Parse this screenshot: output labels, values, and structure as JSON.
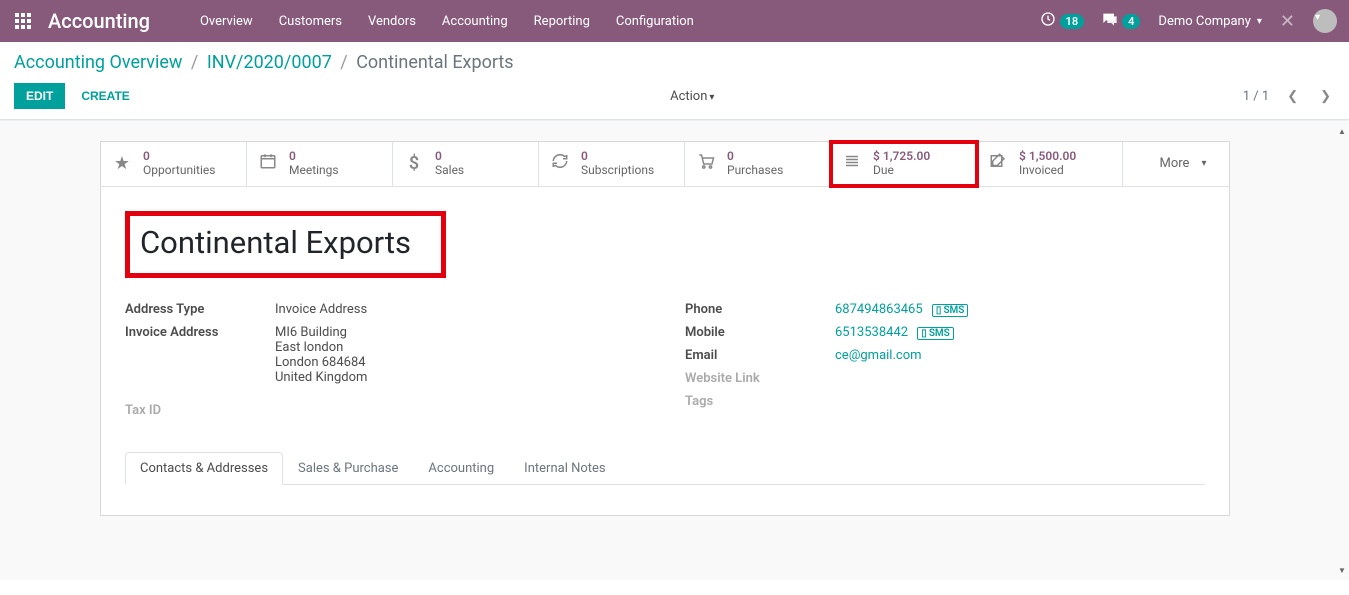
{
  "topnav": {
    "brand": "Accounting",
    "items": [
      "Overview",
      "Customers",
      "Vendors",
      "Accounting",
      "Reporting",
      "Configuration"
    ],
    "clock_badge": "18",
    "chat_badge": "4",
    "company": "Demo Company"
  },
  "breadcrumb": {
    "a": "Accounting Overview",
    "b": "INV/2020/0007",
    "current": "Continental Exports"
  },
  "buttons": {
    "edit": "EDIT",
    "create": "CREATE",
    "action": "Action"
  },
  "pager": {
    "text": "1 / 1"
  },
  "stats": {
    "opportunities": {
      "value": "0",
      "label": "Opportunities"
    },
    "meetings": {
      "value": "0",
      "label": "Meetings"
    },
    "sales": {
      "value": "0",
      "label": "Sales"
    },
    "subscriptions": {
      "value": "0",
      "label": "Subscriptions"
    },
    "purchases": {
      "value": "0",
      "label": "Purchases"
    },
    "due": {
      "value": "$ 1,725.00",
      "label": "Due"
    },
    "invoiced": {
      "value": "$ 1,500.00",
      "label": "Invoiced"
    },
    "more": {
      "label": "More"
    }
  },
  "record": {
    "title": "Continental Exports",
    "labels": {
      "address_type": "Address Type",
      "invoice_address": "Invoice Address",
      "tax_id": "Tax ID",
      "phone": "Phone",
      "mobile": "Mobile",
      "email": "Email",
      "website": "Website Link",
      "tags": "Tags"
    },
    "address_type": "Invoice Address",
    "address_lines": [
      "MI6 Building",
      "East london",
      "London  684684",
      "United Kingdom"
    ],
    "phone": "687494863465",
    "mobile": "6513538442",
    "email": "ce@gmail.com",
    "sms": "SMS"
  },
  "tabs": [
    "Contacts & Addresses",
    "Sales & Purchase",
    "Accounting",
    "Internal Notes"
  ]
}
